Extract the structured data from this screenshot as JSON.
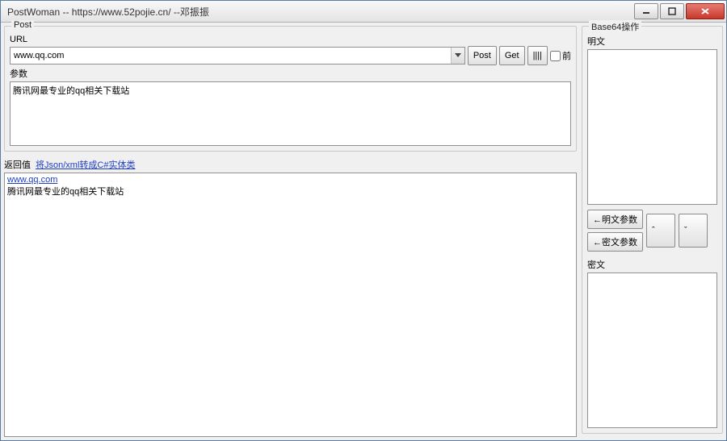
{
  "titlebar": {
    "title": "PostWoman  -- https://www.52pojie.cn/   --邓振振"
  },
  "post_group": {
    "legend": "Post",
    "url_label": "URL",
    "url_value": "www.qq.com",
    "btn_post": "Post",
    "btn_get": "Get",
    "btn_clear": "||||",
    "chk_front": "前",
    "params_label": "参数",
    "params_value": "腾讯网最专业的qq相关下载站",
    "return_label": "返回值",
    "return_link": "将Json/xml转成C#实体类",
    "response_link": "www.qq.com",
    "response_text": "腾讯网最专业的qq相关下载站"
  },
  "base64_group": {
    "legend": "Base64操作",
    "plain_label": "明文",
    "btn_plain_to_param": "←明文参数",
    "btn_cipher_to_param": "←密文参数",
    "btn_up": "ˆ",
    "btn_down": "ˇ",
    "cipher_label": "密文"
  }
}
